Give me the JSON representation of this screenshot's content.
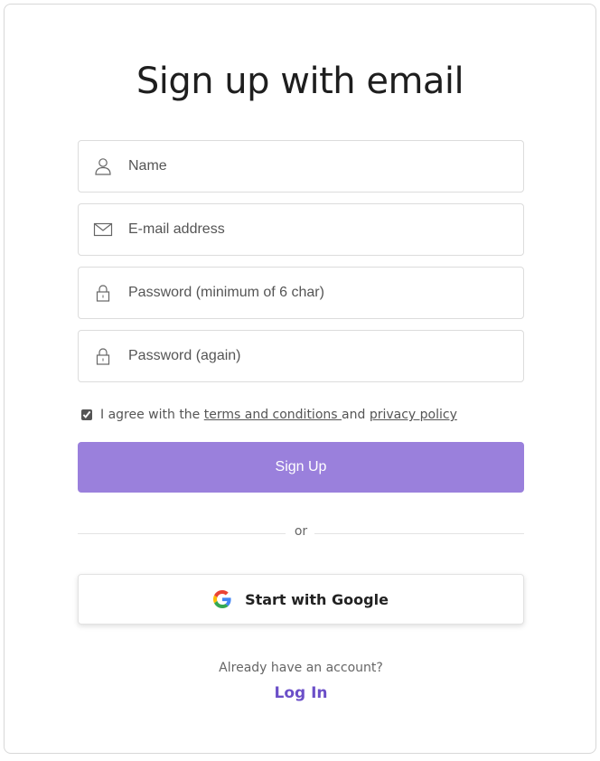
{
  "page": {
    "title": "Sign up with email"
  },
  "form": {
    "name": {
      "placeholder": "Name",
      "value": "",
      "icon": "user-icon"
    },
    "email": {
      "placeholder": "E-mail address",
      "value": "",
      "icon": "mail-icon"
    },
    "password": {
      "placeholder": "Password (minimum of 6 char)",
      "value": "",
      "icon": "lock-icon"
    },
    "password_again": {
      "placeholder": "Password (again)",
      "value": "",
      "icon": "lock-icon"
    },
    "agree": {
      "checked": true,
      "prefix": "I agree with the ",
      "terms_link": "terms and conditions ",
      "middle": "and ",
      "privacy_link": "privacy policy"
    },
    "signup_button": "Sign Up",
    "divider": "or",
    "google_button": "Start with Google"
  },
  "footer": {
    "already_text": "Already have an account?",
    "login_link": "Log In"
  },
  "colors": {
    "primary_button": "#9a80dc",
    "link_accent": "#6b4fc8",
    "border": "#dcdcdc"
  }
}
